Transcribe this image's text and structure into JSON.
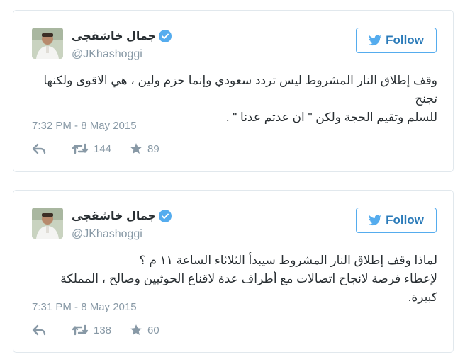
{
  "colors": {
    "accent": "#55acee",
    "follow_text": "#2b7bb9",
    "muted": "#8899a6",
    "text": "#292f33",
    "border": "#e1e8ed"
  },
  "tweets": [
    {
      "author": {
        "name": "جمال خاشقجي",
        "handle": "@JKhashoggi",
        "verified": true
      },
      "follow_label": "Follow",
      "text_lines": [
        "وقف إطلاق النار المشروط ليس تردد سعودي وإنما حزم ولين ، هي الاقوى ولكنها تجنح",
        "للسلم وتقيم الحجة ولكن \" ان عدتم عدنا \" ."
      ],
      "timestamp": "7:32 PM - 8 May 2015",
      "icons": {
        "reply": "reply-icon",
        "retweet": "retweet-icon",
        "favorite": "star-icon"
      },
      "retweets": "144",
      "favorites": "89"
    },
    {
      "author": {
        "name": "جمال خاشقجي",
        "handle": "@JKhashoggi",
        "verified": true
      },
      "follow_label": "Follow",
      "text_lines": [
        "لماذا وقف إطلاق النار المشروط سيبدأ الثلاثاء الساعة ١١ م ؟",
        "لإعطاء فرصة لانجاح اتصالات مع أطراف عدة لاقناع الحوثيين وصالح ، المملكة كبيرة."
      ],
      "timestamp": "7:31 PM - 8 May 2015",
      "icons": {
        "reply": "reply-icon",
        "retweet": "retweet-icon",
        "favorite": "star-icon"
      },
      "retweets": "138",
      "favorites": "60"
    }
  ]
}
